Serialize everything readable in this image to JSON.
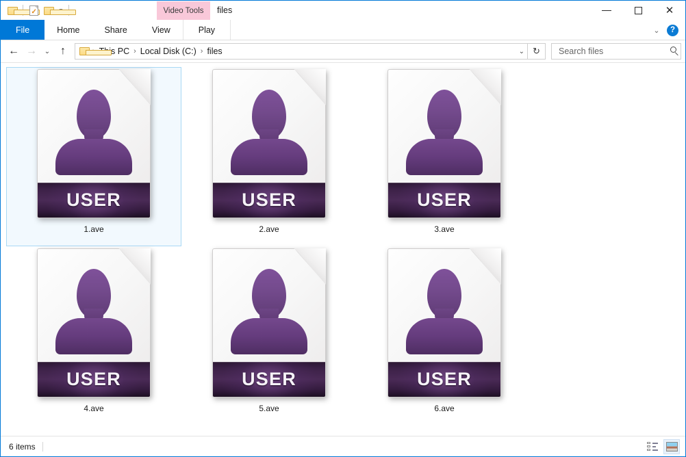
{
  "window": {
    "title": "files",
    "contextual_tab_group": "Video Tools",
    "caption": {
      "minimize": "minimize-button",
      "maximize": "maximize-button",
      "close": "close-button"
    }
  },
  "quick_access": {
    "items": [
      {
        "name": "folder-icon",
        "tooltip": "Folder"
      },
      {
        "name": "properties-icon",
        "tooltip": "Properties"
      },
      {
        "name": "new-folder-icon",
        "tooltip": "New folder"
      }
    ],
    "customize_caret": "▼"
  },
  "ribbon": {
    "tabs": [
      {
        "id": "file",
        "label": "File"
      },
      {
        "id": "home",
        "label": "Home"
      },
      {
        "id": "share",
        "label": "Share"
      },
      {
        "id": "view",
        "label": "View"
      },
      {
        "id": "play",
        "label": "Play"
      }
    ],
    "collapse_chevron": "⌄",
    "help_label": "?"
  },
  "navigation": {
    "back": "←",
    "forward": "→",
    "recent": "⌄",
    "up": "↑",
    "breadcrumb": [
      {
        "label": "This PC"
      },
      {
        "label": "Local Disk (C:)"
      },
      {
        "label": "files"
      }
    ],
    "separator": "›",
    "path_dropdown": "⌄",
    "refresh": "↻"
  },
  "search": {
    "placeholder": "Search files",
    "value": "",
    "icon": "search-icon"
  },
  "files": [
    {
      "label": "1.ave",
      "badge": "USER",
      "selected": true
    },
    {
      "label": "2.ave",
      "badge": "USER",
      "selected": false
    },
    {
      "label": "3.ave",
      "badge": "USER",
      "selected": false
    },
    {
      "label": "4.ave",
      "badge": "USER",
      "selected": false
    },
    {
      "label": "5.ave",
      "badge": "USER",
      "selected": false
    },
    {
      "label": "6.ave",
      "badge": "USER",
      "selected": false
    }
  ],
  "status": {
    "item_count": "6 items",
    "views": [
      {
        "id": "details",
        "name": "details-view-button",
        "active": false
      },
      {
        "id": "large-icons",
        "name": "large-icons-view-button",
        "active": true
      }
    ]
  },
  "colors": {
    "accent": "#0078d7",
    "contextual_group": "#f9c8d9",
    "selection_fill": "#f2f9fe",
    "selection_border": "#a8d8f5",
    "icon_purple": "#74488d",
    "icon_band_dark": "#2b1733"
  }
}
